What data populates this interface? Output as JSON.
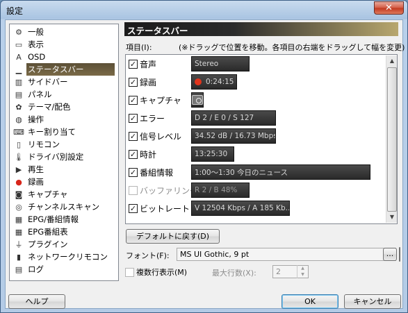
{
  "window": {
    "title": "設定",
    "close_label": "✕"
  },
  "tree": {
    "items": [
      {
        "label": "一般",
        "icon": "gear-icon",
        "glyph": "⚙"
      },
      {
        "label": "表示",
        "icon": "monitor-icon",
        "glyph": "▭"
      },
      {
        "label": "OSD",
        "icon": "osd-icon",
        "glyph": "A"
      },
      {
        "label": "ステータスバー",
        "icon": "statusbar-icon",
        "glyph": "▁"
      },
      {
        "label": "サイドバー",
        "icon": "sidebar-icon",
        "glyph": "▥"
      },
      {
        "label": "パネル",
        "icon": "panel-icon",
        "glyph": "▤"
      },
      {
        "label": "テーマ/配色",
        "icon": "palette-icon",
        "glyph": "✿"
      },
      {
        "label": "操作",
        "icon": "mouse-icon",
        "glyph": "◍"
      },
      {
        "label": "キー割り当て",
        "icon": "keyboard-icon",
        "glyph": "⌨"
      },
      {
        "label": "リモコン",
        "icon": "remote-icon",
        "glyph": "▯"
      },
      {
        "label": "ドライバ別設定",
        "icon": "thermometer-icon",
        "glyph": "🌡"
      },
      {
        "label": "再生",
        "icon": "play-icon",
        "glyph": "▶"
      },
      {
        "label": "録画",
        "icon": "record-icon",
        "glyph": "●"
      },
      {
        "label": "キャプチャ",
        "icon": "camera-icon",
        "glyph": "◙"
      },
      {
        "label": "チャンネルスキャン",
        "icon": "scan-icon",
        "glyph": "◎"
      },
      {
        "label": "EPG/番組情報",
        "icon": "epg-icon",
        "glyph": "▦"
      },
      {
        "label": "EPG番組表",
        "icon": "program-guide-icon",
        "glyph": "▦"
      },
      {
        "label": "プラグイン",
        "icon": "plugin-icon",
        "glyph": "⏚"
      },
      {
        "label": "ネットワークリモコン",
        "icon": "network-remote-icon",
        "glyph": "▮"
      },
      {
        "label": "ログ",
        "icon": "log-icon",
        "glyph": "▤"
      }
    ],
    "selected_index": 3
  },
  "panel": {
    "header": "ステータスバー",
    "items_label": "項目(I):",
    "items_hint": "(※ドラッグで位置を移動。各項目の右端をドラッグして幅を変更)",
    "rows": [
      {
        "checked": true,
        "label": "音声",
        "preview": "Stereo"
      },
      {
        "checked": true,
        "label": "録画",
        "preview": "0:24:15"
      },
      {
        "checked": true,
        "label": "キャプチャ",
        "preview": ""
      },
      {
        "checked": true,
        "label": "エラー",
        "preview": "D 2 / E 0 / S 127"
      },
      {
        "checked": true,
        "label": "信号レベル",
        "preview": "34.52 dB / 16.73 Mbps"
      },
      {
        "checked": true,
        "label": "時計",
        "preview": "13:25:30"
      },
      {
        "checked": true,
        "label": "番組情報",
        "preview": "1:00〜1:30 今日のニュース"
      },
      {
        "checked": false,
        "label": "バッファリング",
        "preview": "R 2 / B 48%"
      },
      {
        "checked": true,
        "label": "ビットレート",
        "preview": "V 12504 Kbps / A 185 Kb..."
      }
    ],
    "check_mark": "✓",
    "default_button": "デフォルトに戻す(D)",
    "font_label": "フォント(F):",
    "font_value": "MS UI Gothic, 9 pt",
    "font_browse": "...",
    "multiline_label": "複数行表示(M)",
    "multiline_checked": false,
    "max_rows_label": "最大行数(X):",
    "max_rows_value": "2"
  },
  "footer": {
    "help": "ヘルプ",
    "ok": "OK",
    "cancel": "キャンセル"
  }
}
